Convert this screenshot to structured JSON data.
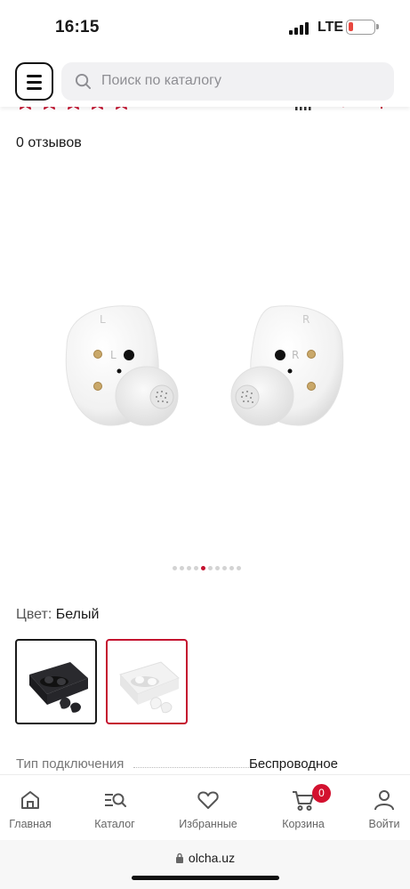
{
  "status": {
    "time": "16:15",
    "network": "LTE",
    "icons": [
      "signal-bars-icon",
      "battery-low-icon"
    ],
    "battery_color": "#e8473f"
  },
  "header": {
    "menu_icon": "hamburger-icon",
    "search_placeholder": "Поиск по каталогу",
    "search_icon": "search-icon"
  },
  "rating": {
    "stars_filled": 0,
    "stars_total": 5,
    "star_color": "#c4122f",
    "action_icons": [
      "compare-icon",
      "heart-icon",
      "cart-plus-icon"
    ]
  },
  "reviews_label": "0 отзывов",
  "gallery": {
    "image_count": 10,
    "active_index": 4,
    "active_color": "#c4122f"
  },
  "color_selector": {
    "label": "Цвет:",
    "value": "Белый",
    "options": [
      {
        "name": "graphite",
        "selected": false
      },
      {
        "name": "white",
        "selected": true
      }
    ]
  },
  "specs": [
    {
      "key": "Тип подключения",
      "value": "Беспроводное"
    }
  ],
  "bottom_nav": {
    "items": [
      {
        "label": "Главная",
        "icon": "home-icon"
      },
      {
        "label": "Каталог",
        "icon": "catalog-search-icon"
      },
      {
        "label": "Избранные",
        "icon": "heart-icon"
      },
      {
        "label": "Корзина",
        "icon": "cart-icon",
        "badge": "0"
      },
      {
        "label": "Войти",
        "icon": "user-icon"
      }
    ],
    "badge_color": "#d3112f"
  },
  "browser": {
    "url": "olcha.uz",
    "icon": "lock-icon"
  },
  "brand_color": "#c4122f"
}
